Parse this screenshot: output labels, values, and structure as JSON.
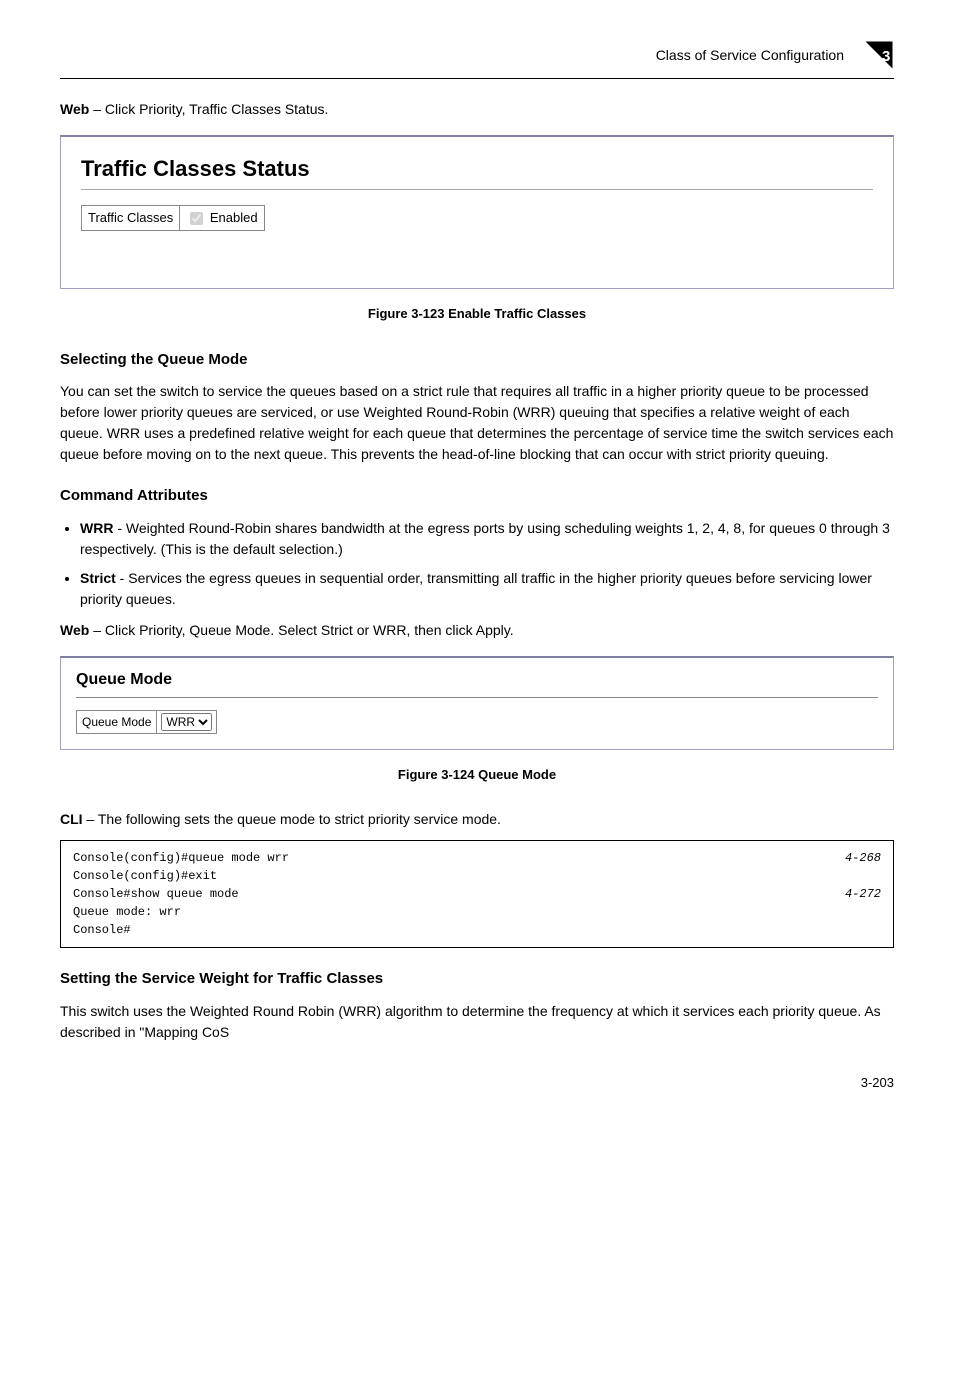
{
  "header": {
    "text": "Class of Service Configuration",
    "chapter": "3"
  },
  "intro1": {
    "bold": "Web",
    "text": " – Click Priority, Traffic Classes Status."
  },
  "panel1": {
    "title": "Traffic Classes Status",
    "label": "Traffic Classes",
    "checkbox_label": "Enabled"
  },
  "figure1": "Figure 3-123  Enable Traffic Classes",
  "section1": {
    "heading": "Selecting the Queue Mode",
    "para": "You can set the switch to service the queues based on a strict rule that requires all traffic in a higher priority queue to be processed before lower priority queues are serviced, or use Weighted Round-Robin (WRR) queuing that specifies a relative weight of each queue. WRR uses a predefined relative weight for each queue that determines the percentage of service time the switch services each queue before moving on to the next queue. This prevents the head-of-line blocking that can occur with strict priority queuing."
  },
  "cmdattr": {
    "heading": "Command Attributes",
    "items": [
      {
        "bold": "WRR",
        "text": " - Weighted Round-Robin shares bandwidth at the egress ports by using scheduling weights 1, 2, 4, 8, for queues 0 through 3 respectively. (This is the default selection.)"
      },
      {
        "bold": "Strict",
        "text": " - Services the egress queues in sequential order, transmitting all traffic in the higher priority queues before servicing lower priority queues."
      }
    ]
  },
  "intro2": {
    "bold": "Web",
    "text": " – Click Priority, Queue Mode. Select Strict or WRR, then click Apply."
  },
  "panel2": {
    "title": "Queue Mode",
    "label": "Queue Mode",
    "select_value": "WRR"
  },
  "figure2": "Figure 3-124  Queue Mode",
  "intro3": {
    "bold": "CLI",
    "text": " – The following sets the queue mode to strict priority service mode."
  },
  "code": {
    "lines": [
      {
        "cmd": "Console(config)#queue mode wrr",
        "ref": "4-268"
      },
      {
        "cmd": "Console(config)#exit",
        "ref": ""
      },
      {
        "cmd": "Console#show queue mode",
        "ref": "4-272"
      },
      {
        "cmd": "Queue mode: wrr",
        "ref": ""
      },
      {
        "cmd": "Console#",
        "ref": ""
      }
    ]
  },
  "section2": {
    "heading": "Setting the Service Weight for Traffic Classes",
    "para": "This switch uses the Weighted Round Robin (WRR) algorithm to determine the frequency at which it services each priority queue. As described in \"Mapping CoS"
  },
  "pagenum": "3-203"
}
